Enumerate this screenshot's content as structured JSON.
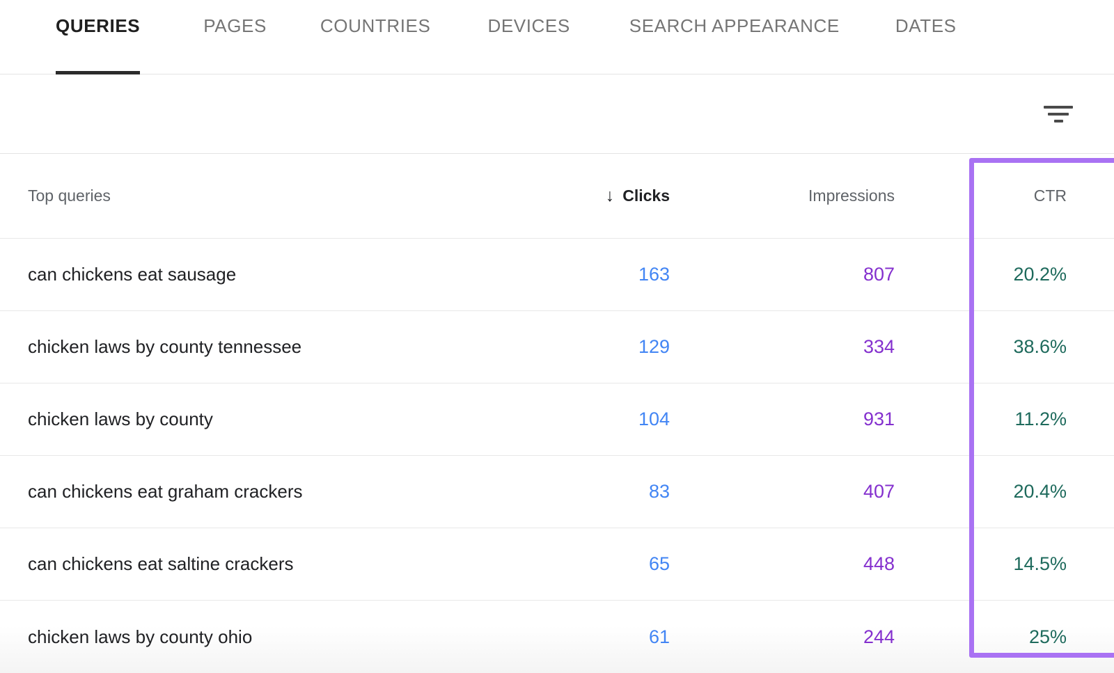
{
  "tabs": [
    {
      "label": "QUERIES",
      "active": true
    },
    {
      "label": "PAGES",
      "active": false
    },
    {
      "label": "COUNTRIES",
      "active": false
    },
    {
      "label": "DEVICES",
      "active": false
    },
    {
      "label": "SEARCH APPEARANCE",
      "active": false
    },
    {
      "label": "DATES",
      "active": false
    }
  ],
  "toolbar": {
    "filter_icon": "filter-icon"
  },
  "table": {
    "columns": {
      "query": "Top queries",
      "clicks": "Clicks",
      "impressions": "Impressions",
      "ctr": "CTR"
    },
    "sort": {
      "column": "Clicks",
      "direction_glyph": "↓"
    },
    "rows": [
      {
        "query": "can chickens eat sausage",
        "clicks": "163",
        "impressions": "807",
        "ctr": "20.2%"
      },
      {
        "query": "chicken laws by county tennessee",
        "clicks": "129",
        "impressions": "334",
        "ctr": "38.6%"
      },
      {
        "query": "chicken laws by county",
        "clicks": "104",
        "impressions": "931",
        "ctr": "11.2%"
      },
      {
        "query": "can chickens eat graham crackers",
        "clicks": "83",
        "impressions": "407",
        "ctr": "20.4%"
      },
      {
        "query": "can chickens eat saltine crackers",
        "clicks": "65",
        "impressions": "448",
        "ctr": "14.5%"
      },
      {
        "query": "chicken laws by county ohio",
        "clicks": "61",
        "impressions": "244",
        "ctr": "25%"
      }
    ]
  },
  "annotation": {
    "highlight_color": "#a972f3",
    "highlight_target": "CTR"
  },
  "colors": {
    "clicks": "#4285f4",
    "impressions": "#8430ce",
    "ctr": "#1e6a5c",
    "active_tab": "#1f1f1f",
    "inactive_tab": "#757575"
  }
}
